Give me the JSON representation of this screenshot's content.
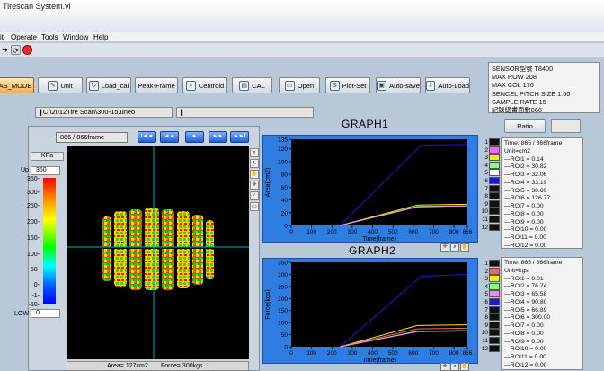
{
  "window": {
    "title": "Tirescan System.vi"
  },
  "menu": [
    "it",
    "Operate",
    "Tools",
    "Window",
    "Help"
  ],
  "toolbar": {
    "buttons": [
      {
        "label": "AS_MODE",
        "icon": ""
      },
      {
        "label": "Unit",
        "icon": "wrench-icon"
      },
      {
        "label": "Load_cal",
        "icon": "refresh-icon"
      },
      {
        "label": "Peak-Frame",
        "icon": ""
      },
      {
        "label": "Centroid",
        "icon": "magnifier-icon"
      },
      {
        "label": "CAL",
        "icon": "clipboard-icon"
      },
      {
        "label": "Open",
        "icon": "folder-icon"
      },
      {
        "label": "Plot-Set",
        "icon": "gear-icon"
      },
      {
        "label": "Auto-save",
        "icon": "save-icon"
      },
      {
        "label": "Auto-Load",
        "icon": "load-icon"
      }
    ]
  },
  "file_path": "C:\\2012Tire Scan\\300-15.uneo",
  "file_path2": "",
  "info": {
    "lines": [
      "SENSOR型號 T8400",
      "MAX ROW 208",
      "MAX COL 176",
      "SENCEL PITCH SIZE  1.50",
      "SAMPLE RATE 15",
      "記錄總畫面數866"
    ]
  },
  "ratio_label": "Ratio",
  "frame": {
    "display": "866 / 866frame"
  },
  "nav": {
    "labels": [
      "I◄◄",
      "◄◄",
      "►",
      "►►",
      "►►I"
    ]
  },
  "scale": {
    "unit": "KPa",
    "up_label": "Up",
    "up_value": "350",
    "low_label": "LOW",
    "low_value": "0",
    "ticks": [
      "350-",
      "300-",
      "250-",
      "200-",
      "150-",
      "100-",
      "50-",
      "0-",
      "-1-",
      "-50-"
    ]
  },
  "footer": {
    "area": "Area=  127cm2",
    "force": "Force=  300kgs"
  },
  "graph1": {
    "title": "GRAPH1",
    "legend": [
      "Time: 865 / 866frame",
      "Unit=cm2",
      "—ROI1 = 0.14",
      "—ROI2 = 30.82",
      "—ROI3 = 32.06",
      "—ROI4 = 33.19",
      "—ROI5 = 30.69",
      "—ROI6 = 126.77",
      "—ROI7 = 0.00",
      "—ROI8 = 0.00",
      "—ROI9 = 0.00",
      "—ROI10 = 0.00",
      "—ROI11 = 0.00",
      "—ROI12 = 0.00"
    ]
  },
  "graph2": {
    "title": "GRAPH2",
    "legend": [
      "Time: 865 / 866frame",
      "Unit=kgs",
      "—ROI1 = 0.01",
      "—ROI2 = 76.74",
      "—ROI3 = 65.58",
      "—ROI4 = 90.80",
      "—ROI5 = 66.89",
      "—ROI6 = 300.00",
      "—ROI7 = 0.00",
      "—ROI8 = 0.00",
      "—ROI9 = 0.00",
      "—ROI10 = 0.00",
      "—ROI11 = 0.00",
      "—ROI12 = 0.00"
    ]
  },
  "roi_numbers": [
    "1",
    "2",
    "3",
    "4",
    "5",
    "6",
    "7",
    "8",
    "9",
    "10",
    "11",
    "12"
  ],
  "chart_data": [
    {
      "type": "line",
      "title": "GRAPH1",
      "xlabel": "Time(frame)",
      "ylabel": "Area(cm2)",
      "xlim": [
        0,
        866
      ],
      "ylim": [
        0,
        135
      ],
      "xticks": [
        0,
        100,
        200,
        300,
        400,
        500,
        600,
        700,
        800,
        866
      ],
      "yticks": [
        0,
        20,
        40,
        60,
        80,
        100,
        120,
        135
      ],
      "series": [
        {
          "color": "#1a1ad6",
          "x": [
            240,
            640,
            866
          ],
          "y": [
            0,
            126,
            126.77
          ]
        },
        {
          "color": "#f0f000",
          "x": [
            240,
            620,
            866
          ],
          "y": [
            0,
            32,
            33.19
          ]
        },
        {
          "color": "#80ff80",
          "x": [
            240,
            620,
            866
          ],
          "y": [
            0,
            30,
            30.69
          ]
        },
        {
          "color": "#ff80ff",
          "x": [
            240,
            620,
            866
          ],
          "y": [
            0,
            29,
            30.82
          ]
        }
      ]
    },
    {
      "type": "line",
      "title": "GRAPH2",
      "xlabel": "Time(frame)",
      "ylabel": "Force(kgs)",
      "xlim": [
        0,
        866
      ],
      "ylim": [
        0,
        350
      ],
      "xticks": [
        0,
        100,
        200,
        300,
        400,
        500,
        600,
        700,
        800,
        866
      ],
      "yticks": [
        0,
        50,
        100,
        150,
        200,
        250,
        300,
        350
      ],
      "series": [
        {
          "color": "#1a1ad6",
          "x": [
            240,
            640,
            866
          ],
          "y": [
            0,
            292,
            300
          ]
        },
        {
          "color": "#f0f000",
          "x": [
            240,
            620,
            866
          ],
          "y": [
            0,
            88,
            90.8
          ]
        },
        {
          "color": "#ff6060",
          "x": [
            240,
            620,
            866
          ],
          "y": [
            0,
            74,
            76.74
          ]
        },
        {
          "color": "#80ff80",
          "x": [
            240,
            620,
            866
          ],
          "y": [
            0,
            64,
            66.89
          ]
        },
        {
          "color": "#ff80ff",
          "x": [
            240,
            620,
            866
          ],
          "y": [
            0,
            62,
            65.58
          ]
        }
      ]
    }
  ]
}
